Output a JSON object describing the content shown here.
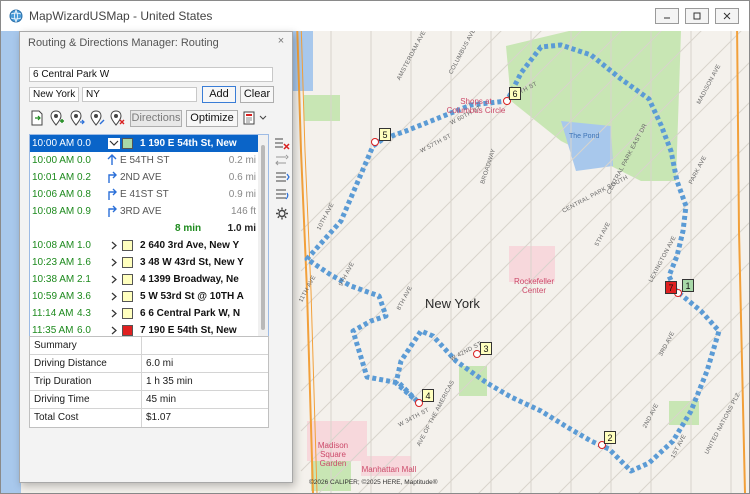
{
  "window": {
    "title": "MapWizardUSMap - United States",
    "controls": [
      "minimize",
      "maximize",
      "close"
    ]
  },
  "dialog": {
    "title": "Routing & Directions Manager: Routing",
    "close_glyph": "×",
    "address_value": "6 Central Park W",
    "city_value": "New York",
    "state_value": "NY",
    "add_label": "Add",
    "clear_label": "Clear",
    "directions_label": "Directions",
    "optimize_label": "Optimize"
  },
  "stops_list": [
    {
      "kind": "stop",
      "time": "10:00 AM",
      "dist": "0.0",
      "label": "1 190 E 54th St, New",
      "color": "#a8d8a8",
      "selected": true,
      "expanded": true
    },
    {
      "kind": "dir",
      "time": "10:00 AM",
      "dist": "0.0",
      "arrow": "up",
      "street": "E 54TH ST",
      "seg": "0.2 mi"
    },
    {
      "kind": "dir",
      "time": "10:01 AM",
      "dist": "0.2",
      "arrow": "right",
      "street": "2ND AVE",
      "seg": "0.6 mi"
    },
    {
      "kind": "dir",
      "time": "10:06 AM",
      "dist": "0.8",
      "arrow": "right",
      "street": "E 41ST ST",
      "seg": "0.9 mi"
    },
    {
      "kind": "dir",
      "time": "10:08 AM",
      "dist": "0.9",
      "arrow": "right",
      "street": "3RD AVE",
      "seg": "146 ft"
    },
    {
      "kind": "total",
      "time_total": "8 min",
      "dist_total": "1.0 mi"
    },
    {
      "kind": "stop",
      "time": "10:08 AM",
      "dist": "1.0",
      "label": "2 640 3rd Ave, New Y",
      "color": "#ffffbe"
    },
    {
      "kind": "stop",
      "time": "10:23 AM",
      "dist": "1.6",
      "label": "3 48 W 43rd St, New Y",
      "color": "#ffffbe"
    },
    {
      "kind": "stop",
      "time": "10:38 AM",
      "dist": "2.1",
      "label": "4 1399 Broadway, Ne",
      "color": "#ffffbe"
    },
    {
      "kind": "stop",
      "time": "10:59 AM",
      "dist": "3.6",
      "label": "5 W 53rd St @ 10TH A",
      "color": "#ffffbe"
    },
    {
      "kind": "stop",
      "time": "11:14 AM",
      "dist": "4.3",
      "label": "6 6 Central Park W, N",
      "color": "#ffffbe"
    },
    {
      "kind": "stop",
      "time": "11:35 AM",
      "dist": "6.0",
      "label": "7 190 E 54th St, New",
      "color": "#e02020"
    }
  ],
  "summary": {
    "header": "Summary",
    "rows": [
      {
        "key": "Driving Distance",
        "value": "6.0 mi"
      },
      {
        "key": "Trip Duration",
        "value": "1 h 35 min"
      },
      {
        "key": "Driving Time",
        "value": "45 min"
      },
      {
        "key": "Total Cost",
        "value": "$1.07"
      }
    ]
  },
  "map": {
    "city_label": "New York",
    "pois": [
      "Shops at Columbus Circle",
      "Rockefeller Center",
      "Madison Square Garden",
      "Manhattan Mall"
    ],
    "water_label": "The Pond",
    "copyright": "©2026 CALIPER; ©2025 HERE, Maptitude®",
    "stop_numbers": [
      "1",
      "2",
      "3",
      "4",
      "5",
      "6",
      "7"
    ],
    "street_labels": [
      "AMSTERDAM AVE",
      "COLUMBUS AVE",
      "W 60TH ST",
      "W 57TH ST",
      "W 65TH ST",
      "BROADWAY",
      "CENTRAL PARK SOUTH",
      "5TH AVE",
      "CENTRAL PARK EAST DR",
      "MADISON AVE",
      "PARK AVE",
      "LEXINGTON AVE",
      "3RD AVE",
      "2ND AVE",
      "1ST AVE",
      "UNITED NATIONS PLZ",
      "11TH AVE",
      "10TH AVE",
      "9TH AVE",
      "8TH AVE",
      "AVE OF THE AMERICAS",
      "W 42ND ST",
      "W 34TH ST"
    ],
    "colors": {
      "route": "#5b9bd5",
      "park": "#c8e6b4",
      "water": "#a8c8ec",
      "highway": "#f2a03a",
      "poi_area": "#f7d8dc"
    }
  }
}
